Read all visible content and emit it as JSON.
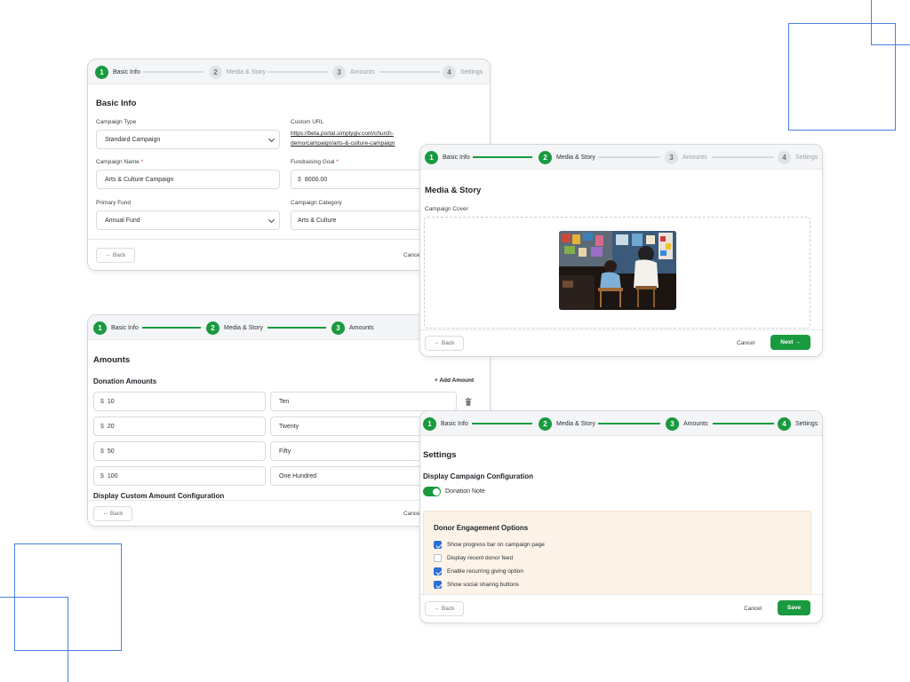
{
  "colors": {
    "accent": "#1a9a3f",
    "decoration": "#4a7fe0",
    "checkbox": "#2a6fd6",
    "engagement_bg": "#fdf3e8"
  },
  "steps": [
    "Basic Info",
    "Media & Story",
    "Amounts",
    "Settings"
  ],
  "step_numbers": [
    "1",
    "2",
    "3",
    "4"
  ],
  "back_label": "← Back",
  "cancel_label": "Cancel",
  "next_label": "Next →",
  "save_label": "Save",
  "basic": {
    "title": "Basic Info",
    "campaign_type_label": "Campaign Type",
    "campaign_type_value": "Standard Campaign",
    "custom_url_label": "Custom URL",
    "custom_url_line1": "https://beta.portal.simplygiv.com/church-",
    "custom_url_line2": "demo/campaign/arts-&-culture-campaign",
    "campaign_name_label": "Campaign Name",
    "campaign_name_value": "Arts & Culture Campaign",
    "goal_label": "Fundraising Goal",
    "goal_currency": "$",
    "goal_value": "8000.00",
    "required_mark": "*",
    "fund_label": "Primary Fund",
    "fund_value": "Annual Fund",
    "category_label": "Campaign Category",
    "category_value": "Arts & Culture",
    "cancel_partial": "Cance"
  },
  "media": {
    "title": "Media & Story",
    "cover_label": "Campaign Cover",
    "cover_image": "children-painting-photo"
  },
  "amounts": {
    "title": "Amounts",
    "donation_title": "Donation Amounts",
    "add_label": "+ Add Amount",
    "currency": "$",
    "rows": [
      {
        "amount": "10",
        "label": "Ten"
      },
      {
        "amount": "20",
        "label": "Twenty"
      },
      {
        "amount": "50",
        "label": "Fifty"
      },
      {
        "amount": "100",
        "label": "One Hundred"
      }
    ],
    "custom_title": "Display Custom Amount Configuration",
    "cancel_partial": "Cance"
  },
  "settings": {
    "title": "Settings",
    "display_title": "Display Campaign Configuration",
    "donation_note_label": "Donation Note",
    "donation_note_enabled": true,
    "engagement_title": "Donor Engagement Options",
    "options": [
      {
        "label": "Show progress bar on campaign page",
        "checked": true
      },
      {
        "label": "Display recent donor feed",
        "checked": false
      },
      {
        "label": "Enable recurring giving option",
        "checked": true
      },
      {
        "label": "Show social sharing buttons",
        "checked": true
      }
    ]
  }
}
